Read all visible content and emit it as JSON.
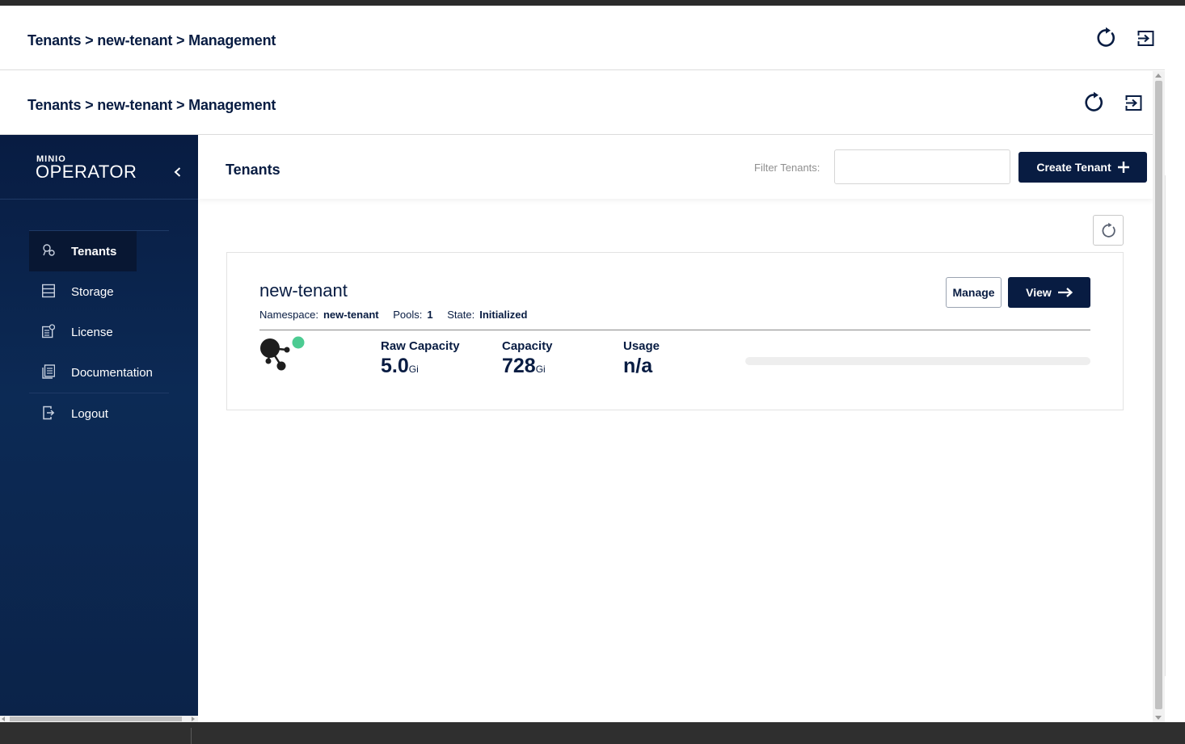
{
  "breadcrumb": {
    "part1": "Tenants",
    "sep1": ">",
    "part2": "new-tenant",
    "sep2": ">",
    "part3": "Management"
  },
  "brand": {
    "small": "MINIO",
    "name": "OPERATOR"
  },
  "sidebar": {
    "items": [
      {
        "label": "Tenants",
        "icon": "tenants-icon",
        "active": true
      },
      {
        "label": "Storage",
        "icon": "storage-icon"
      },
      {
        "label": "License",
        "icon": "license-icon"
      },
      {
        "label": "Documentation",
        "icon": "documentation-icon"
      },
      {
        "label": "Logout",
        "icon": "logout-icon"
      }
    ]
  },
  "page": {
    "title": "Tenants",
    "filter_label": "Filter Tenants:",
    "filter_value": "",
    "create_label": "Create Tenant"
  },
  "tenant": {
    "name": "new-tenant",
    "namespace_label": "Namespace:",
    "namespace": "new-tenant",
    "pools_label": "Pools:",
    "pools": "1",
    "state_label": "State:",
    "state": "Initialized",
    "manage_label": "Manage",
    "view_label": "View",
    "health_color": "#4ccb92",
    "raw_capacity_label": "Raw Capacity",
    "raw_capacity_value": "5.0",
    "raw_capacity_unit": "Gi",
    "capacity_label": "Capacity",
    "capacity_value": "728",
    "capacity_unit": "Gi",
    "usage_label": "Usage",
    "usage_value": "n/a",
    "usage_fraction": 0
  },
  "colors": {
    "brand_dark": "#081c42",
    "sidebar_active": "#081733",
    "status_green": "#4ccb92"
  }
}
